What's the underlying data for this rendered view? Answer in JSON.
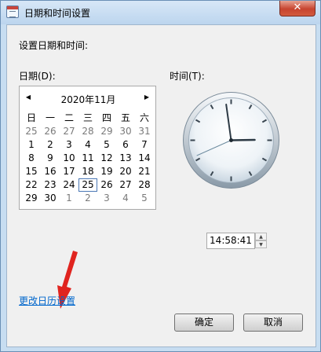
{
  "window": {
    "title": "日期和时间设置",
    "close": "✕"
  },
  "heading": "设置日期和时间:",
  "date_label": "日期(D):",
  "time_label": "时间(T):",
  "calendar": {
    "month_title": "2020年11月",
    "weekdays": [
      "日",
      "一",
      "二",
      "三",
      "四",
      "五",
      "六"
    ],
    "weeks": [
      [
        "25",
        "26",
        "27",
        "28",
        "29",
        "30",
        "31"
      ],
      [
        "1",
        "2",
        "3",
        "4",
        "5",
        "6",
        "7"
      ],
      [
        "8",
        "9",
        "10",
        "11",
        "12",
        "13",
        "14"
      ],
      [
        "15",
        "16",
        "17",
        "18",
        "19",
        "20",
        "21"
      ],
      [
        "22",
        "23",
        "24",
        "25",
        "26",
        "27",
        "28"
      ],
      [
        "29",
        "30",
        "1",
        "2",
        "3",
        "4",
        "5"
      ]
    ],
    "selected_day": "25"
  },
  "time": {
    "value": "14:58:41",
    "hour": 14,
    "minute": 58,
    "second": 41
  },
  "change_calendar_link": "更改日历设置",
  "buttons": {
    "ok": "确定",
    "cancel": "取消"
  }
}
